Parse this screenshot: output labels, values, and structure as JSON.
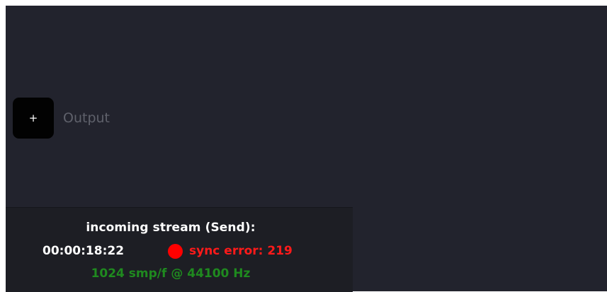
{
  "output": {
    "add_button_label": "+",
    "label": "Output"
  },
  "stream_status": {
    "title": "incoming stream (Send):",
    "timecode": "00:00:18:22",
    "sync_error": "sync error: 219",
    "sample_info": "1024 smp/f @ 44100 Hz"
  },
  "colors": {
    "panel_background": "#22232d",
    "status_background": "#1d1e24",
    "error_red": "#ff0000",
    "ok_green": "#1f8a1f"
  },
  "icons": {
    "add": "plus-icon",
    "sync_status": "status-dot-icon"
  }
}
